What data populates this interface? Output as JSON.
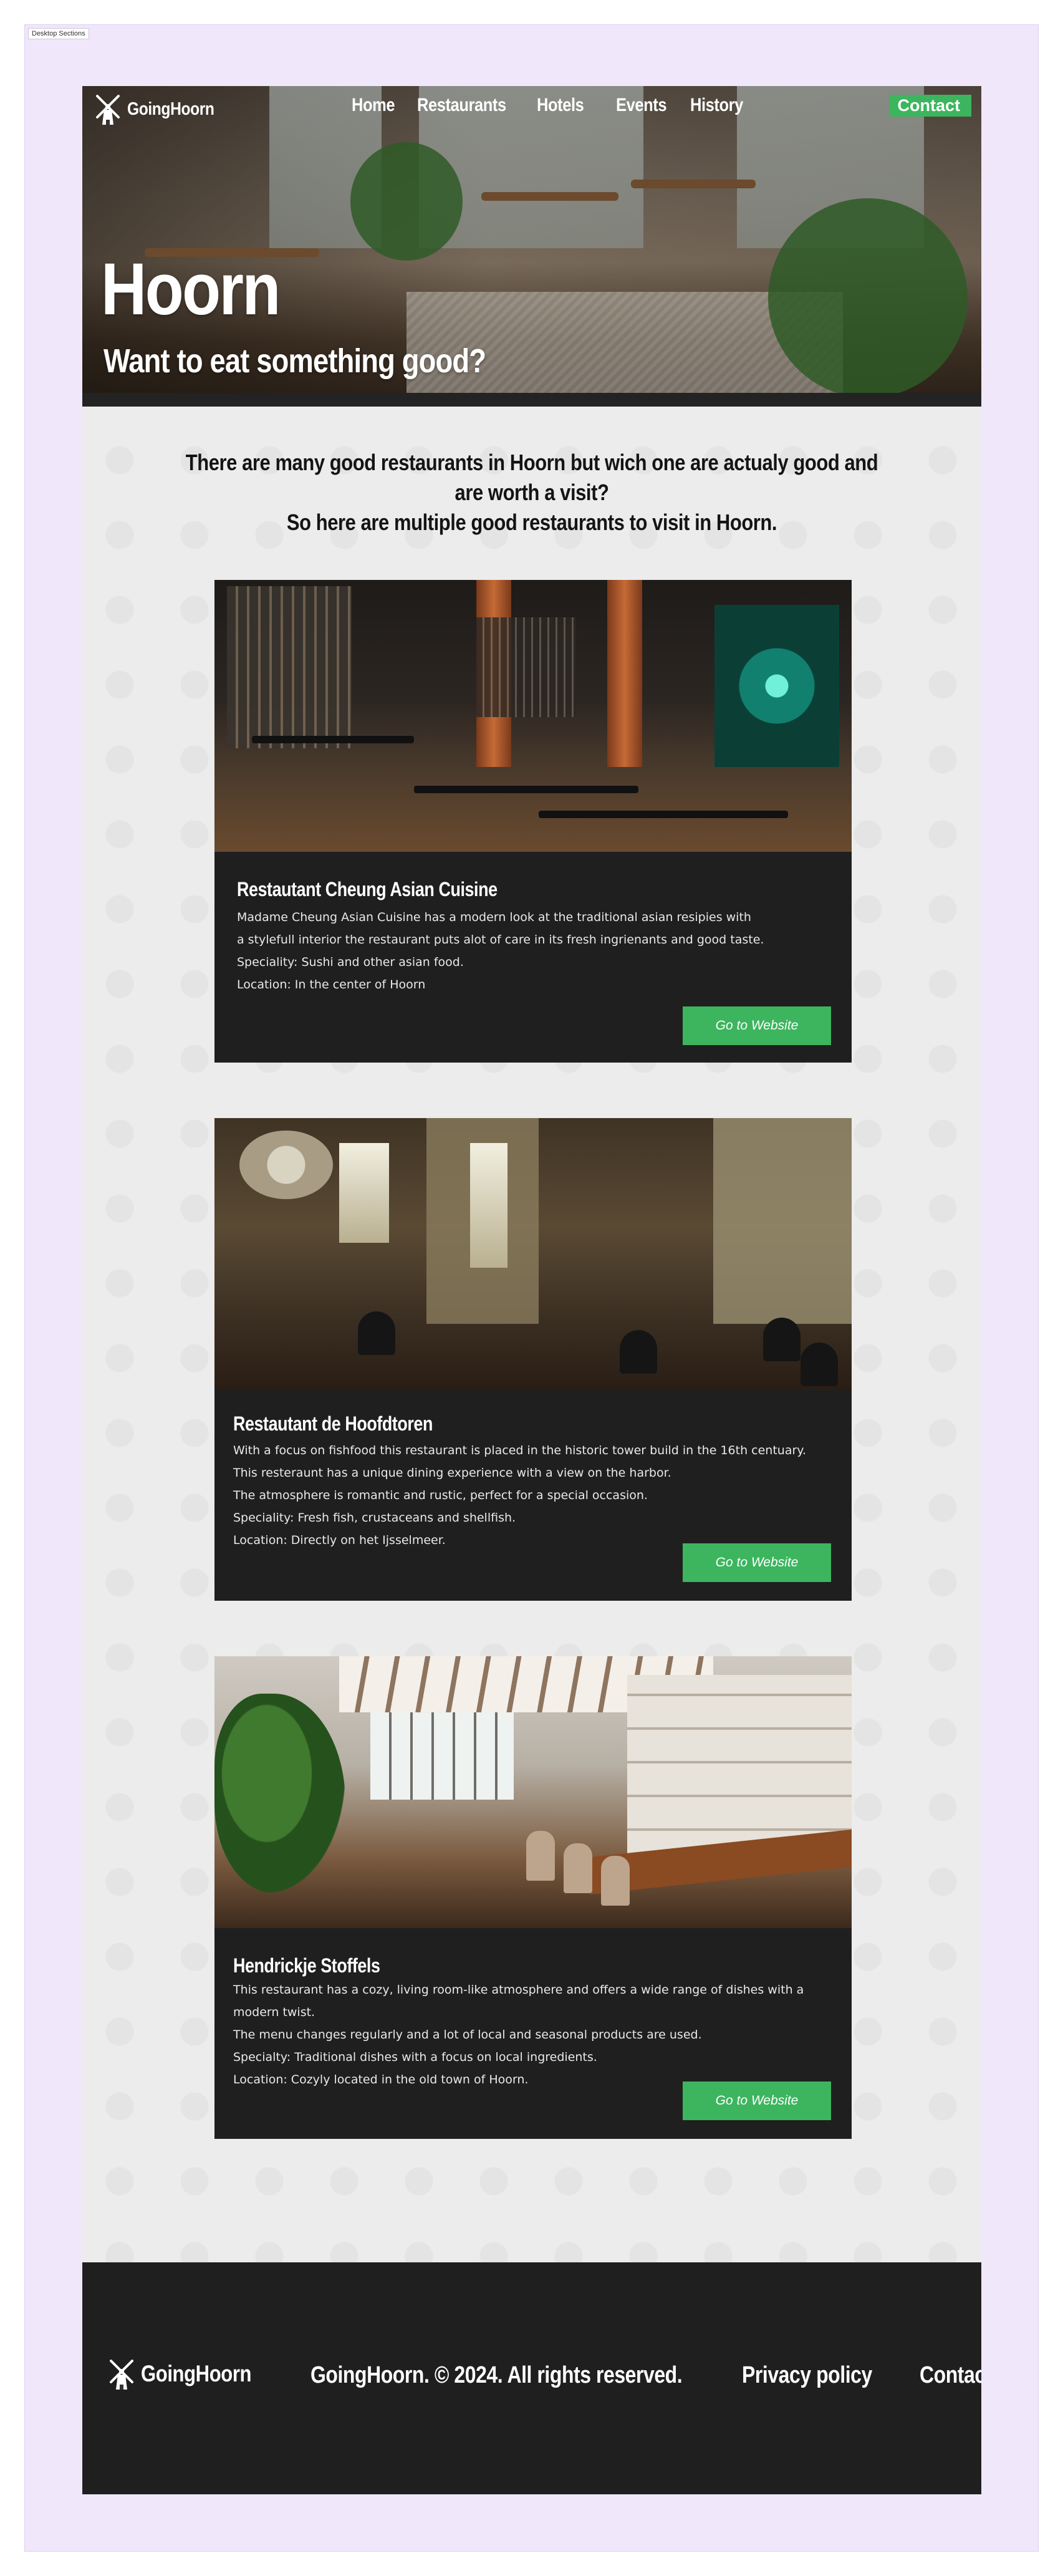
{
  "frame": {
    "label": "Desktop Sections"
  },
  "header": {
    "brand": "GoingHoorn",
    "nav": [
      "Home",
      "Restaurants",
      "Hotels",
      "Events",
      "History"
    ],
    "contact": "Contact"
  },
  "hero": {
    "title": "Hoorn",
    "subtitle": "Want to eat something good?"
  },
  "intro": {
    "line1": "There are many good restaurants in Hoorn but wich one are actualy good and",
    "line2": "are worth a visit?",
    "line3": "So here are multiple good restaurants to visit in Hoorn."
  },
  "restaurants": [
    {
      "name": "Restautant Cheung Asian Cuisine",
      "lines": [
        "Madame Cheung Asian Cuisine has a modern look at the traditional asian resipies with",
        "a stylefull interior the restaurant puts alot of care in its fresh ingrienants and good taste.",
        "Speciality: Sushi and other asian food.",
        "Location: In the center of Hoorn"
      ],
      "button": "Go to Website"
    },
    {
      "name": "Restautant de Hoofdtoren",
      "lines": [
        "With a focus on fishfood this restaurant is placed in the historic tower build in the 16th centuary.",
        "This resteraunt has a unique dining experience with a view on the harbor.",
        "The atmosphere is romantic and rustic, perfect for a special occasion.",
        "Speciality: Fresh fish, crustaceans and shellfish.",
        "Location: Directly on het Ijsselmeer."
      ],
      "button": "Go to Website"
    },
    {
      "name": "Hendrickje Stoffels",
      "lines": [
        "This restaurant has a cozy, living room-like atmosphere and offers a wide range of dishes with a",
        "modern twist.",
        "The menu changes regularly and a lot of local and seasonal products are used.",
        "Specialty: Traditional dishes with a focus on local ingredients.",
        "Location: Cozyly located in the old town of Hoorn."
      ],
      "button": "Go to Website"
    }
  ],
  "footer": {
    "brand": "GoingHoorn",
    "copyright": "GoingHoorn. © 2024. All rights reserved.",
    "links": [
      "Privacy policy",
      "Contact"
    ]
  },
  "colors": {
    "accent": "#3cb55e",
    "dark": "#1f1f1f",
    "canvas": "#f1e7fb",
    "page": "#ececec"
  },
  "icons": {
    "logo": "windmill-icon"
  }
}
